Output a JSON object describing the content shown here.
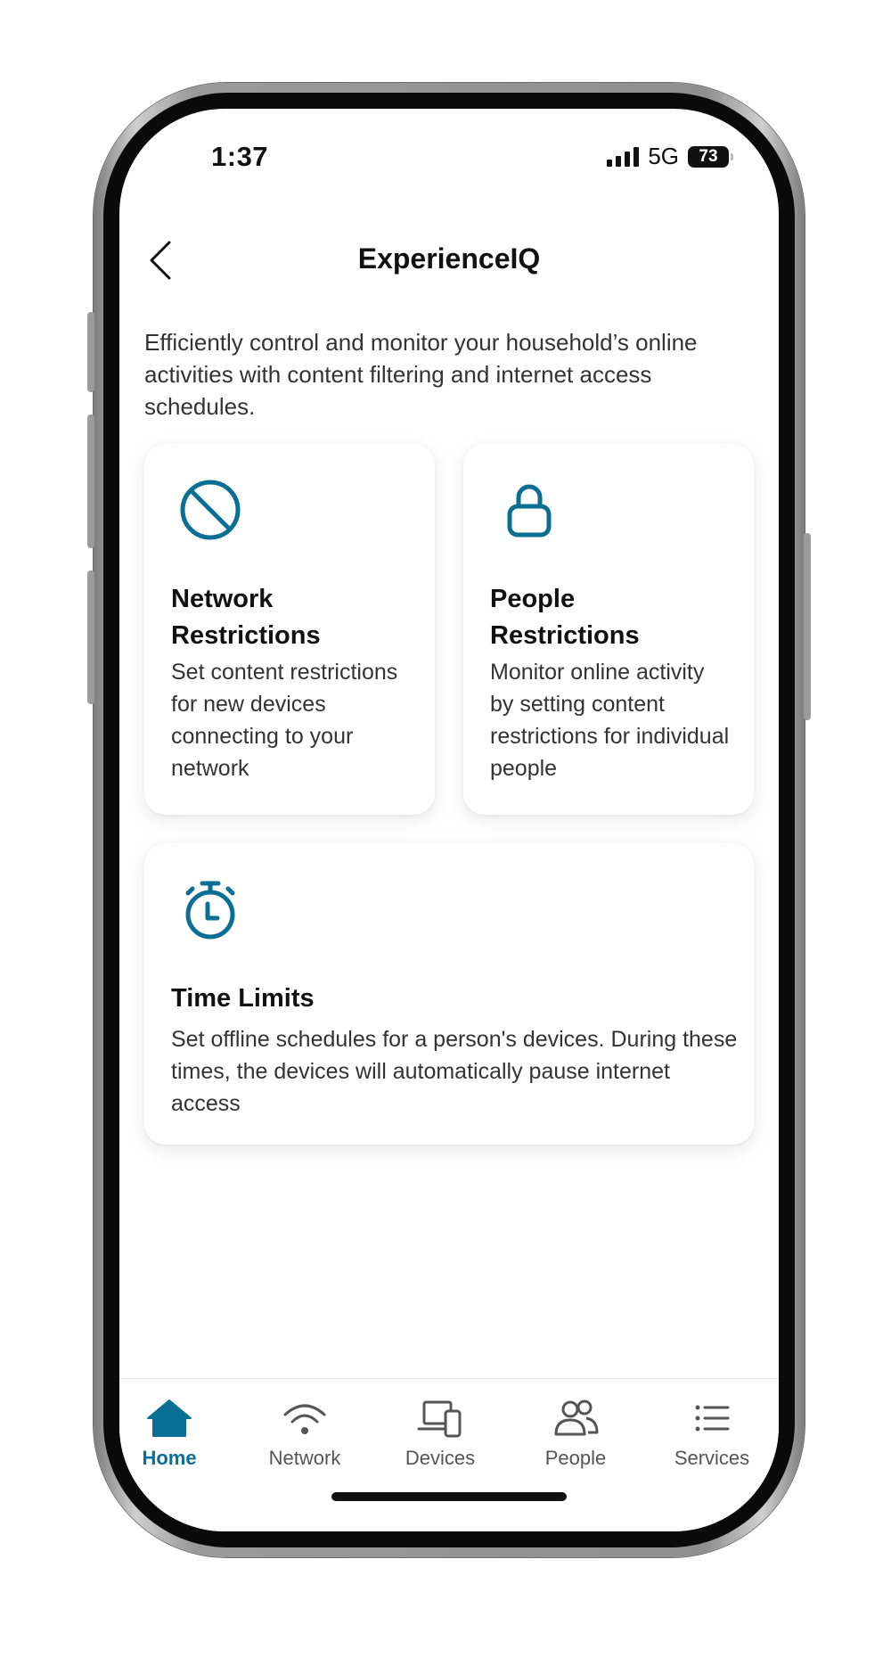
{
  "status_bar": {
    "time": "1:37",
    "network": "5G",
    "battery": "73"
  },
  "header": {
    "title": "ExperienceIQ",
    "back_icon": "chevron-left-icon"
  },
  "intro_text": "Efficiently control and monitor your household’s online activities with content filtering and internet access schedules.",
  "cards": [
    {
      "icon": "prohibited-icon",
      "title": "Network Restrictions",
      "description": "Set content restrictions for new devices connecting to your network"
    },
    {
      "icon": "lock-icon",
      "title": "People Restrictions",
      "description": "Monitor online activity by setting content restrictions for individual people"
    },
    {
      "icon": "stopwatch-icon",
      "title": "Time Limits",
      "description": "Set offline schedules for a person's devices. During these times, the devices will automatically pause internet access"
    }
  ],
  "tabs": [
    {
      "label": "Home",
      "icon": "home-icon",
      "active": true
    },
    {
      "label": "Network",
      "icon": "wifi-icon",
      "active": false
    },
    {
      "label": "Devices",
      "icon": "devices-icon",
      "active": false
    },
    {
      "label": "People",
      "icon": "people-icon",
      "active": false
    },
    {
      "label": "Services",
      "icon": "list-icon",
      "active": false
    }
  ],
  "colors": {
    "accent": "#0b6f93",
    "text_primary": "#111111",
    "text_secondary": "#333333",
    "tab_inactive": "#555555"
  }
}
